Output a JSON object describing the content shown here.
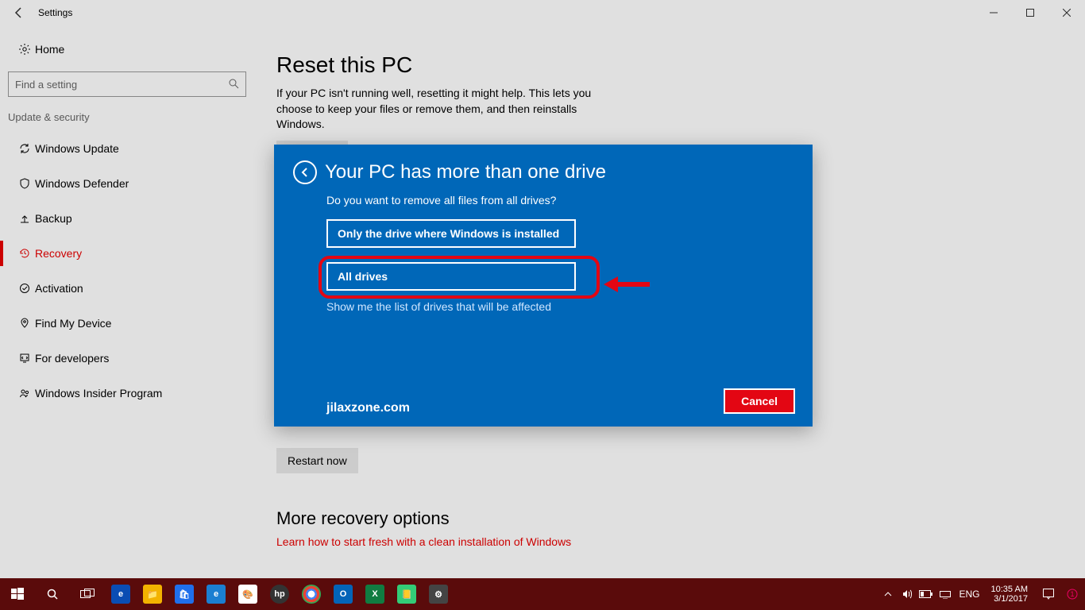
{
  "window": {
    "title": "Settings"
  },
  "sidebar": {
    "home": "Home",
    "search_placeholder": "Find a setting",
    "section": "Update & security",
    "items": [
      {
        "label": "Windows Update"
      },
      {
        "label": "Windows Defender"
      },
      {
        "label": "Backup"
      },
      {
        "label": "Recovery"
      },
      {
        "label": "Activation"
      },
      {
        "label": "Find My Device"
      },
      {
        "label": "For developers"
      },
      {
        "label": "Windows Insider Program"
      }
    ]
  },
  "main": {
    "reset_heading": "Reset this PC",
    "reset_desc": "If your PC isn't running well, resetting it might help. This lets you choose to keep your files or remove them, and then reinstalls Windows.",
    "restart_btn": "Restart now",
    "more_heading": "More recovery options",
    "more_link": "Learn how to start fresh with a clean installation of Windows"
  },
  "dialog": {
    "title": "Your PC has more than one drive",
    "question": "Do you want to remove all files from all drives?",
    "option1": "Only the drive where Windows is installed",
    "option2": "All drives",
    "show_link": "Show me the list of drives that will be affected",
    "cancel": "Cancel",
    "watermark": "jilaxzone.com"
  },
  "taskbar": {
    "lang": "ENG",
    "time": "10:35 AM",
    "date": "3/1/2017"
  }
}
